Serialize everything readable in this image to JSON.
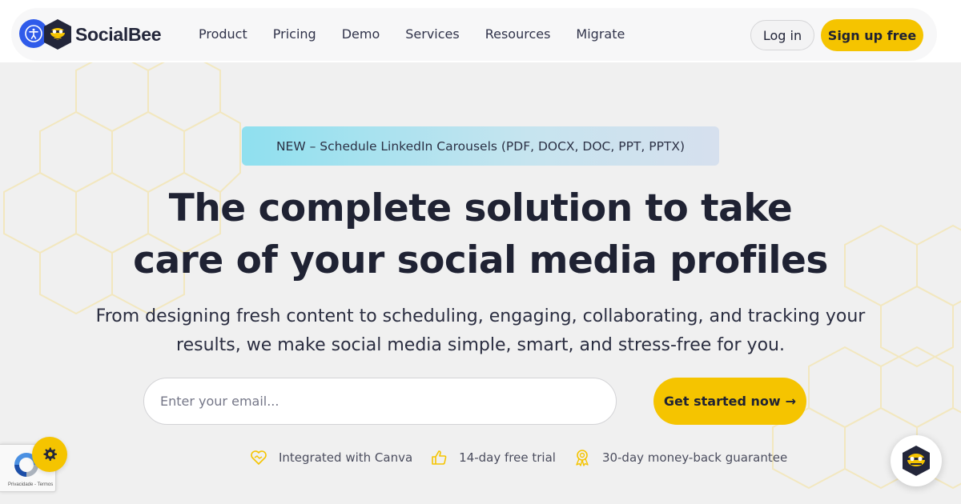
{
  "brand": {
    "name": "SocialBee",
    "colors": {
      "accent": "#f5c400",
      "dark": "#23263a",
      "a11y": "#2f5bea",
      "announce_from": "#8fe0ef",
      "announce_to": "#d6e0ee"
    }
  },
  "nav": {
    "items": [
      {
        "label": "Product"
      },
      {
        "label": "Pricing"
      },
      {
        "label": "Demo"
      },
      {
        "label": "Services"
      },
      {
        "label": "Resources"
      },
      {
        "label": "Migrate"
      }
    ],
    "login_label": "Log in",
    "signup_label": "Sign up free"
  },
  "hero": {
    "announcement": "NEW – Schedule LinkedIn Carousels (PDF, DOCX, DOC, PPT, PPTX)",
    "headline_line1": "The complete solution to take",
    "headline_line2": "care of your social media profiles",
    "subhead_line1": "From designing fresh content to scheduling, engaging, collaborating, and tracking your",
    "subhead_line2": "results, we make social media simple, smart, and stress-free for you.",
    "email_placeholder": "Enter your email...",
    "cta_label": "Get started now",
    "cta_arrow": "→"
  },
  "features": [
    {
      "icon": "heart-handshake-icon",
      "label": "Integrated with Canva"
    },
    {
      "icon": "thumbs-up-icon",
      "label": "14-day free trial"
    },
    {
      "icon": "award-ribbon-icon",
      "label": "30-day money-back guarantee"
    }
  ],
  "widgets": {
    "recaptcha_text": "Privacidade - Termos",
    "settings_icon": "gear-icon",
    "chat_icon": "bee-logo-icon",
    "a11y_icon": "accessibility-icon"
  }
}
